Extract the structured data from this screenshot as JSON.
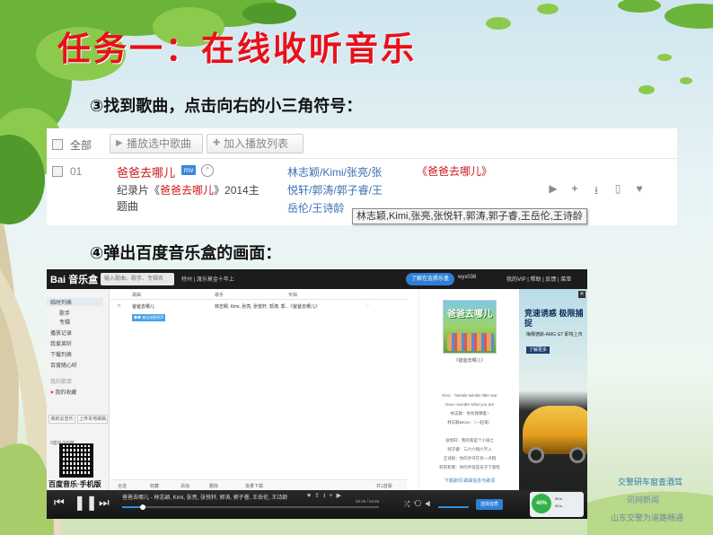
{
  "slide": {
    "title": "任务一：在线收听音乐",
    "step3": "③找到歌曲，点击向右的小三角符号：",
    "step4": "④弹出百度音乐盒的画面："
  },
  "song_panel": {
    "select_all": "全部",
    "play_selected": "播放选中歌曲",
    "add_to_list": "加入播放列表",
    "row": {
      "number": "01",
      "song": "爸爸去哪儿",
      "mv_badge": "mv",
      "desc_prefix": "纪录片《",
      "desc_link": "爸爸去哪儿",
      "desc_suffix": "》2014主题曲",
      "artists": "林志颖/Kimi/张亮/张悦轩/郭涛/郭子睿/王岳伦/王诗龄",
      "album": "《爸爸去哪儿》"
    },
    "tooltip": "林志颖,Kimi,张亮,张悦轩,郭涛,郭子睿,王岳伦,王诗龄"
  },
  "music_box": {
    "logo": "Bai 音乐盒",
    "search_placeholder": "输入歌曲、歌手、专辑名",
    "hot_search": "特州 | 渡乐莫金十年上",
    "top_button": "了解在金质乐盒",
    "user": "wyx036",
    "top_right": "我的VIP | 帮助 | 反馈 | 菜单",
    "sidebar": {
      "playlist": "临时列表",
      "singer": "歌手",
      "album": "专辑",
      "history": "播放记录",
      "recommend": "我爱某听",
      "download": "下载列表",
      "random": "百度随心听",
      "section": "我的歌单",
      "favorite": "我的收藏",
      "tab_cloud": "我的云音乐",
      "tab_upload": "上传本地歌曲",
      "storage": "0首/8,000首",
      "brand": "百度音乐·手机版"
    },
    "list": {
      "col_song": "歌曲",
      "col_singer": "歌手",
      "col_album": "专辑",
      "row_song": "爸爸去哪儿",
      "row_singer": "林志颖, Kimi, 张亮, 张悦轩, 郭涛, 郭...",
      "row_album": "《爸爸去哪儿》",
      "mv_tag": "◆◆ 来自电影原声",
      "foot_all": "全选",
      "foot_fav": "收藏",
      "foot_add": "添加",
      "foot_del": "删除",
      "foot_dl": "批量下载",
      "foot_count": "共1首歌"
    },
    "lyric": {
      "cover_text": "爸爸去哪儿",
      "cover_title": "《爸爸去哪儿》",
      "lines": [
        "Kimi：Twinkle twinkle little star",
        "How i wonder what you are",
        "林志颖：你有我撑着 !",
        "林志颖&Kimi：（一起来）",
        "",
        "张悦轩：我的家是个小骑士",
        "郭子睿：三六六啊六不入",
        "王诗龄：你的手牙在有一点粗",
        "轩轩和我：你的手就是孩子下意暗"
      ],
      "bottom": "下载歌词  歌曲信息与歌词"
    },
    "ad": {
      "title": "竞速诱惑 极限捕捉",
      "subtitle": "梅赛德斯-AMG GT 即将上市",
      "button": "了解更多"
    },
    "player": {
      "title": "爸爸去哪儿 - 林志颖, Kimi, 张亮, 张悦轩, 郭涛, 郭子睿, 王岳伦, 王诗龄",
      "time": "00:26 / 04:55",
      "progress": 0.08,
      "button": "选择音质",
      "percent": "40%",
      "speed_up": "0K/s",
      "speed_down": "0K/s"
    }
  },
  "background": {
    "news": "山东交警为道路畅通",
    "strip": "交警研车窗查酒驾",
    "strip2": "讯网新闻"
  },
  "colors": {
    "title": "#e8101a",
    "song_red": "#c8171d",
    "artist_blue": "#3a6fb5",
    "player_accent": "#2f8de0"
  }
}
